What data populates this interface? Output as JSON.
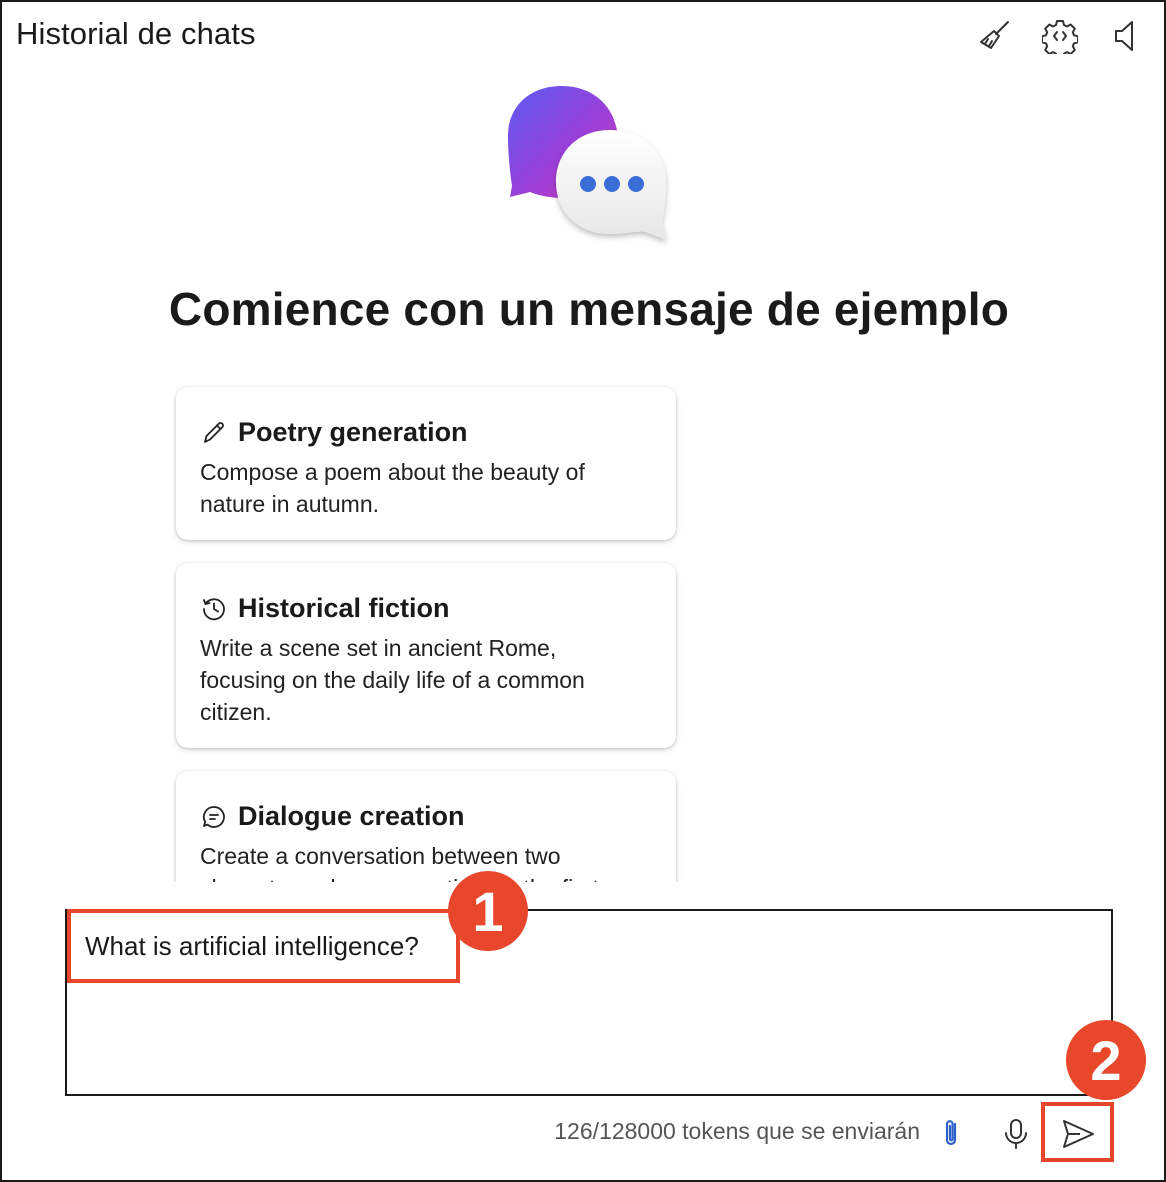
{
  "header": {
    "title": "Historial de chats",
    "icons": [
      "broom-icon",
      "settings-gear-icon",
      "speaker-icon"
    ]
  },
  "hero": {
    "icon": "chat-bubbles-icon",
    "heading": "Comience con un mensaje de ejemplo"
  },
  "cards": [
    {
      "icon": "pencil-icon",
      "title": "Poetry generation",
      "description": "Compose a poem about the beauty of nature in autumn."
    },
    {
      "icon": "history-icon",
      "title": "Historical fiction",
      "description": "Write a scene set in ancient Rome, focusing on the daily life of a common citizen."
    },
    {
      "icon": "chat-icon",
      "title": "Dialogue creation",
      "description": "Create a conversation between two characters who are meeting for the first time."
    }
  ],
  "input": {
    "value": "What is artificial intelligence?"
  },
  "footer": {
    "tokens_text": "126/128000 tokens que se enviarán",
    "icons": [
      "paperclip-icon",
      "microphone-icon",
      "send-icon"
    ]
  },
  "annotations": {
    "badge1": "1",
    "badge2": "2",
    "color": "#e8472c"
  }
}
